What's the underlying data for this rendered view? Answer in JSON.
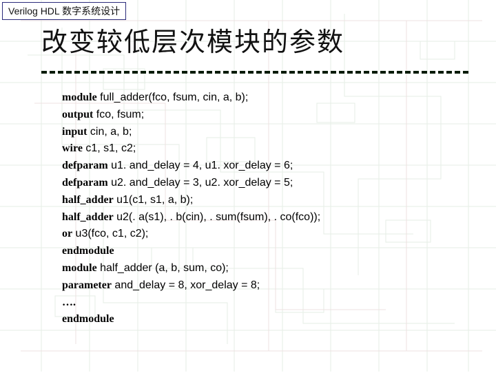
{
  "header": {
    "label": "Verilog HDL 数字系统设计"
  },
  "title": "改变较低层次模块的参数",
  "code": {
    "lines": [
      {
        "kw": "module",
        "rest": " full_adder(fco, fsum, cin, a, b);"
      },
      {
        "kw": "output",
        "rest": " fco, fsum;"
      },
      {
        "kw": "input",
        "rest": " cin, a, b;"
      },
      {
        "kw": "wire",
        "rest": " c1, s1, c2;"
      },
      {
        "kw": "defparam",
        "rest": " u1. and_delay = 4, u1. xor_delay = 6;"
      },
      {
        "kw": "defparam",
        "rest": " u2. and_delay = 3, u2. xor_delay = 5;"
      },
      {
        "kw": "half_adder",
        "rest": " u1(c1, s1, a, b);"
      },
      {
        "kw": "half_adder",
        "rest": " u2(. a(s1), . b(cin), . sum(fsum), . co(fco));"
      },
      {
        "kw": "or",
        "rest": " u3(fco, c1, c2);"
      },
      {
        "kw": "endmodule",
        "rest": ""
      },
      {
        "kw": "module",
        "rest": " half_adder (a, b, sum, co);"
      },
      {
        "kw": "parameter",
        "rest": " and_delay = 8, xor_delay = 8;"
      },
      {
        "kw": "….",
        "rest": ""
      },
      {
        "kw": "endmodule",
        "rest": ""
      }
    ]
  }
}
